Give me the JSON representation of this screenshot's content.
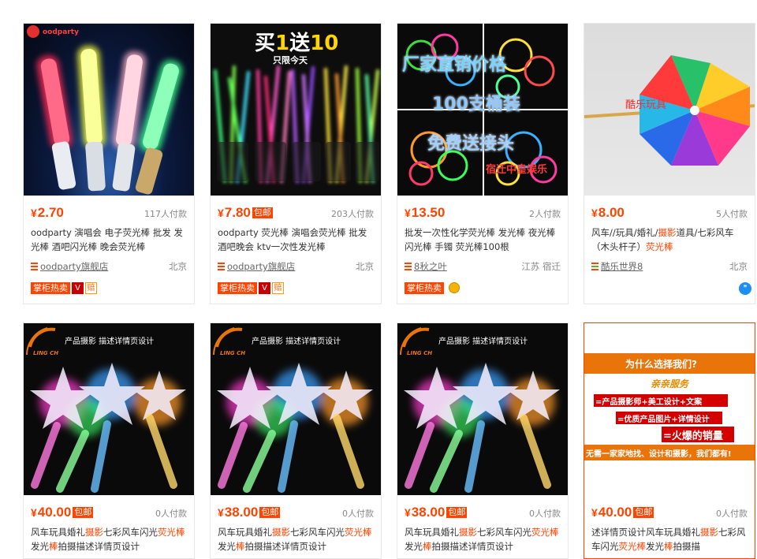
{
  "cards": [
    {
      "price": "2.70",
      "free_shipping": "",
      "payers": "117人付款",
      "title_parts": [
        {
          "t": "oodparty 演唱会 电子荧光棒 批发 发光棒 酒吧闪光棒 晚会荧光棒",
          "hl": false
        }
      ],
      "shop": "oodparty旗舰店",
      "location": "北京",
      "badges": {
        "hot": "掌柜热卖",
        "red": "V",
        "orange": "赔"
      },
      "image": {
        "logo_text": "oodparty"
      }
    },
    {
      "price": "7.80",
      "free_shipping": "包邮",
      "payers": "203人付款",
      "title_parts": [
        {
          "t": "oodparty 荧光棒 演唱会荧光棒 批发 酒吧晚会 ktv一次性发光棒",
          "hl": false
        }
      ],
      "shop": "oodparty旗舰店",
      "location": "北京",
      "badges": {
        "hot": "掌柜热卖",
        "red": "V",
        "orange": "赔"
      },
      "image": {
        "headline_a": "买",
        "headline_num1": "1",
        "headline_b": "送",
        "headline_num2": "10",
        "sub": "只限今天"
      }
    },
    {
      "price": "13.50",
      "free_shipping": "",
      "payers": "2人付款",
      "title_parts": [
        {
          "t": "批发一次性化学荧光棒 发光棒 夜光棒 闪光棒 手镯 荧光棒100根",
          "hl": false
        }
      ],
      "shop": "8秋之叶",
      "location": "江苏 宿迁",
      "badges": {
        "hot": "掌柜热卖"
      },
      "image": {
        "line1": "厂家直销价格",
        "line2": "100支桶装",
        "line3": "免费送接头",
        "corner": "宿迁中皇娱乐"
      }
    },
    {
      "price": "8.00",
      "free_shipping": "",
      "payers": "5人付款",
      "title_parts": [
        {
          "t": "风车//玩具/婚礼/",
          "hl": false
        },
        {
          "t": "摄影",
          "hl": true
        },
        {
          "t": "道具/七彩风车（木头杆子）",
          "hl": false
        },
        {
          "t": "荧光棒",
          "hl": true
        }
      ],
      "shop": "酷乐世界8",
      "location": "北京",
      "badges": {},
      "image": {
        "watermark": "酷乐玩具"
      }
    },
    {
      "price": "40.00",
      "free_shipping": "包邮",
      "payers": "0人付款",
      "title_parts": [
        {
          "t": "风车玩具婚礼",
          "hl": false
        },
        {
          "t": "摄影",
          "hl": true
        },
        {
          "t": "七彩风车闪光",
          "hl": false
        },
        {
          "t": "荧光棒",
          "hl": true
        },
        {
          "t": "发光",
          "hl": false
        },
        {
          "t": "棒",
          "hl": true
        },
        {
          "t": "拍摄描述详情页设计",
          "hl": false
        }
      ],
      "image": {
        "label": "产品摄影  描述详情页设计",
        "brand": "LING CH"
      }
    },
    {
      "price": "38.00",
      "free_shipping": "包邮",
      "payers": "0人付款",
      "title_parts": [
        {
          "t": "风车玩具婚礼",
          "hl": false
        },
        {
          "t": "摄影",
          "hl": true
        },
        {
          "t": "七彩风车闪光",
          "hl": false
        },
        {
          "t": "荧光棒",
          "hl": true
        },
        {
          "t": "发光",
          "hl": false
        },
        {
          "t": "棒",
          "hl": true
        },
        {
          "t": "拍摄描述详情页设计",
          "hl": false
        }
      ],
      "image": {
        "label": "产品摄影  描述详情页设计",
        "brand": "LING CH"
      }
    },
    {
      "price": "38.00",
      "free_shipping": "包邮",
      "payers": "0人付款",
      "title_parts": [
        {
          "t": "风车玩具婚礼",
          "hl": false
        },
        {
          "t": "摄影",
          "hl": true
        },
        {
          "t": "七彩风车闪光",
          "hl": false
        },
        {
          "t": "荧光棒",
          "hl": true
        },
        {
          "t": "发光",
          "hl": false
        },
        {
          "t": "棒",
          "hl": true
        },
        {
          "t": "拍摄描述详情页设计",
          "hl": false
        }
      ],
      "image": {
        "label": "产品摄影  描述详情页设计",
        "brand": "LING CH"
      }
    },
    {
      "price": "40.00",
      "free_shipping": "包邮",
      "payers": "0人付款",
      "title_parts": [
        {
          "t": "述详情页设计风车玩具婚礼",
          "hl": false
        },
        {
          "t": "摄影",
          "hl": true
        },
        {
          "t": "七彩风车闪光",
          "hl": false
        },
        {
          "t": "荧光棒",
          "hl": true
        },
        {
          "t": "发光",
          "hl": false
        },
        {
          "t": "棒",
          "hl": true
        },
        {
          "t": "拍摄描",
          "hl": false
        }
      ],
      "image": {
        "q": "为什么选择我们?",
        "service": "亲亲服务",
        "b1": "=产品摄影师+美工设计+文案",
        "b2": "=优质产品图片+详情设计",
        "b3": "=火爆的销量",
        "foot": "无需一家家地找、设计和摄影，我们都有!"
      }
    }
  ],
  "currency_symbol": "¥",
  "colors": {
    "accent": "#ff4400",
    "border": "#e8e8e8"
  }
}
